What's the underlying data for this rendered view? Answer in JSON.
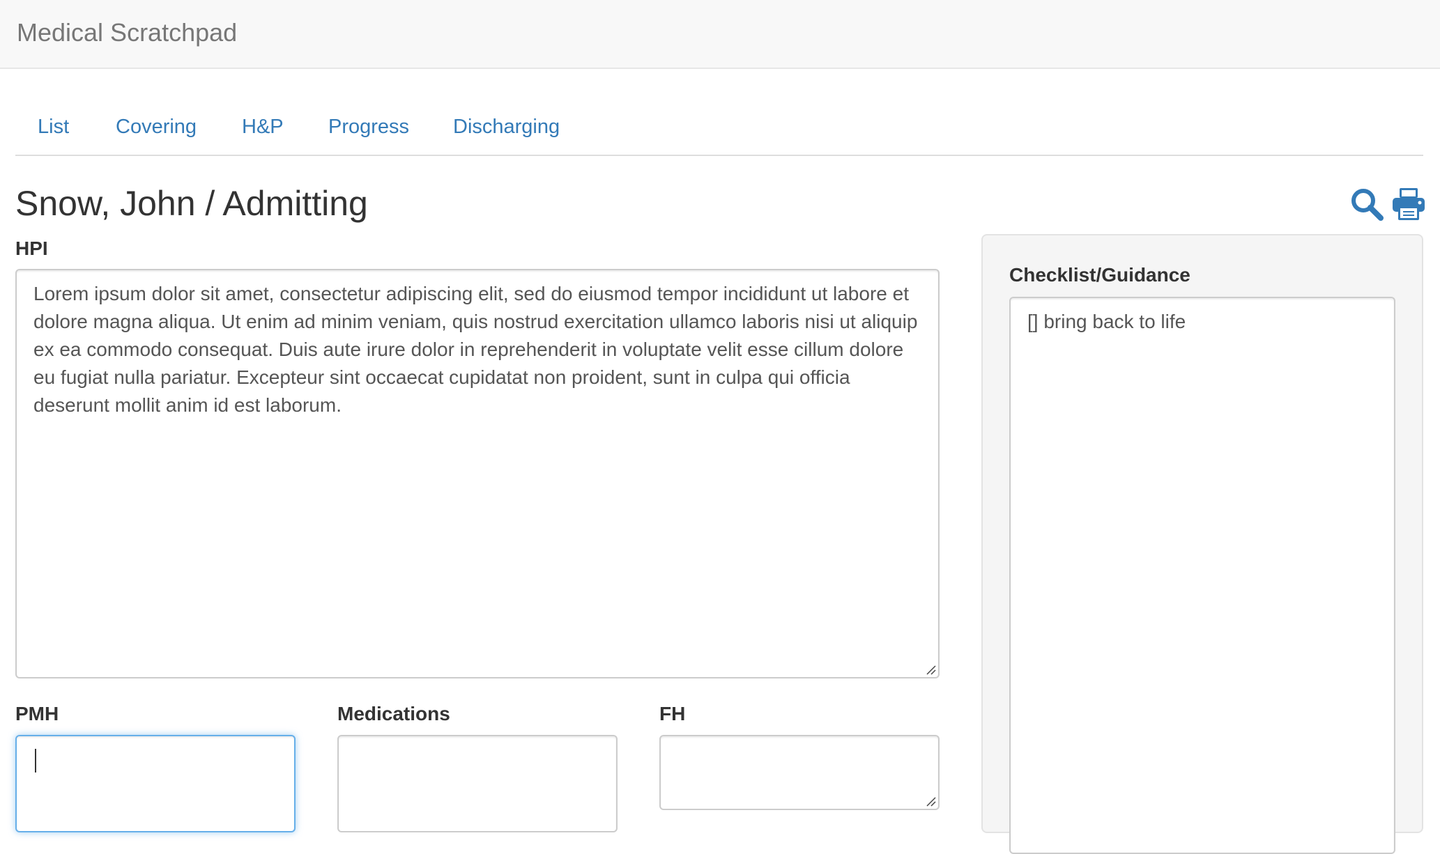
{
  "app": {
    "brand": "Medical Scratchpad"
  },
  "nav": {
    "tabs": [
      {
        "label": "List"
      },
      {
        "label": "Covering"
      },
      {
        "label": "H&P"
      },
      {
        "label": "Progress"
      },
      {
        "label": "Discharging"
      }
    ]
  },
  "header": {
    "title": "Snow, John / Admitting",
    "icons": [
      "search-icon",
      "print-icon"
    ]
  },
  "hpi": {
    "label": "HPI",
    "value": "Lorem ipsum dolor sit amet, consectetur adipiscing elit, sed do eiusmod tempor incididunt ut labore et dolore magna aliqua. Ut enim ad minim veniam, quis nostrud exercitation ullamco laboris nisi ut aliquip ex ea commodo consequat. Duis aute irure dolor in reprehenderit in voluptate velit esse cillum dolore eu fugiat nulla pariatur. Excepteur sint occaecat cupidatat non proident, sunt in culpa qui officia deserunt mollit anim id est laborum."
  },
  "pmh": {
    "label": "PMH",
    "value": ""
  },
  "medications": {
    "label": "Medications",
    "value": ""
  },
  "fh": {
    "label": "FH",
    "value": ""
  },
  "checklist": {
    "label": "Checklist/Guidance",
    "value": "[] bring back to life"
  },
  "colors": {
    "link": "#337ab7",
    "navbar_bg": "#f8f8f8",
    "well_bg": "#f5f5f5",
    "focus_border": "#66afe9"
  }
}
